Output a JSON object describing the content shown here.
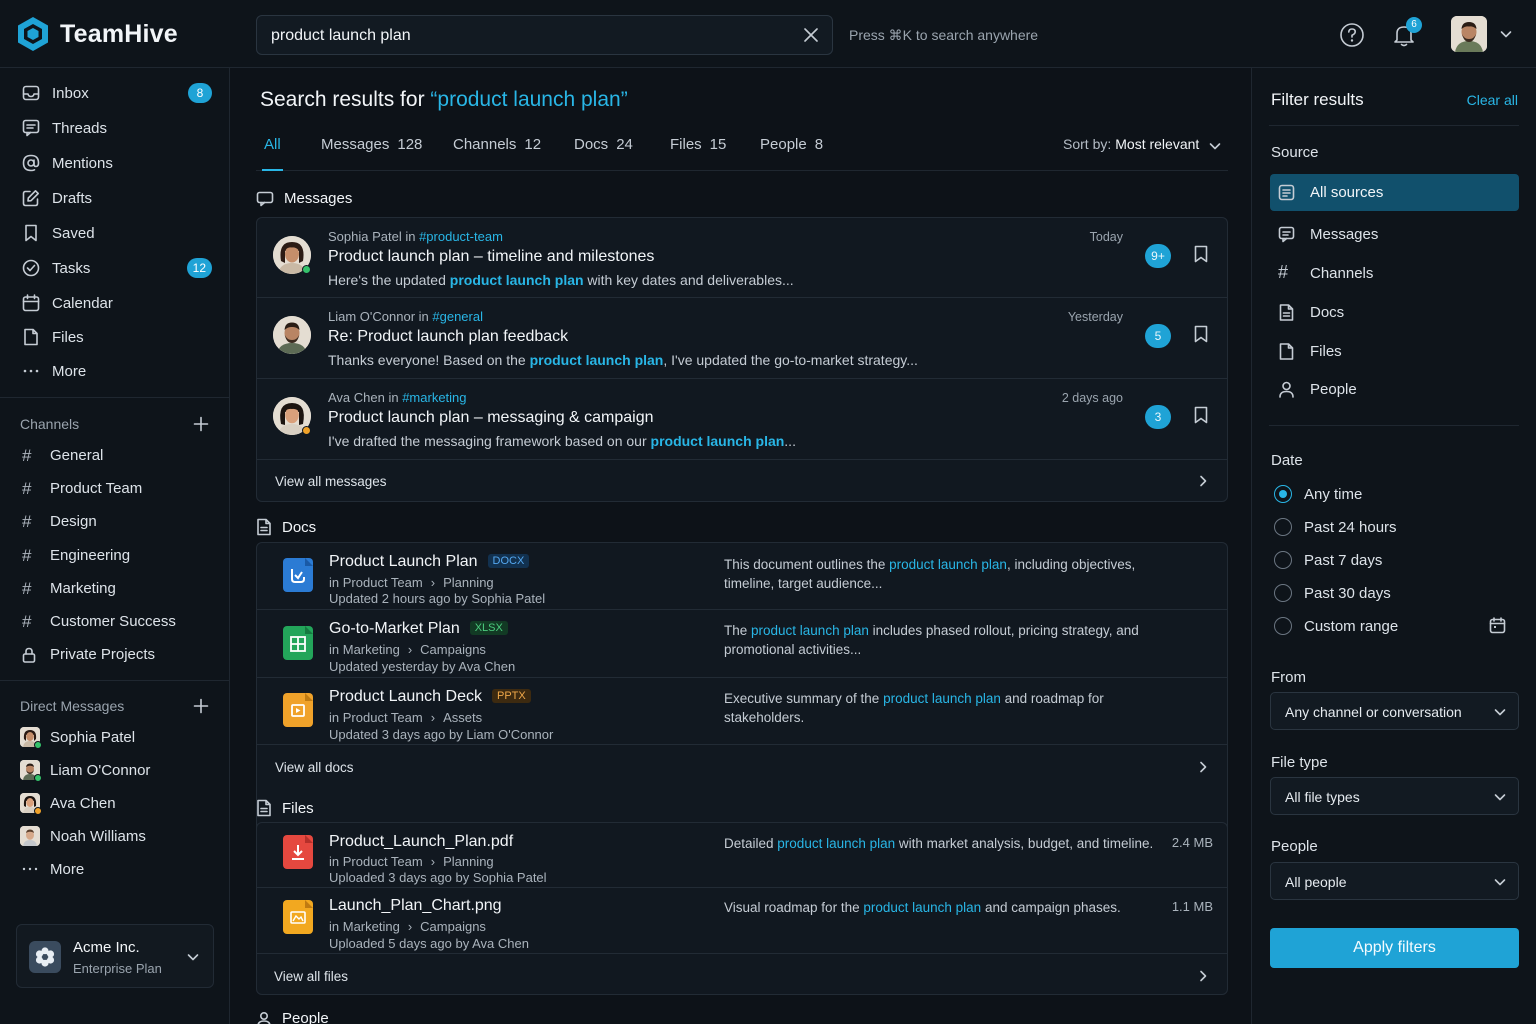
{
  "brand": {
    "name": "TeamHive"
  },
  "search": {
    "value": "product launch plan",
    "hint": "Press ⌘K to search anywhere"
  },
  "topbar": {
    "notification_count": "6"
  },
  "sidebar": {
    "nav": [
      {
        "label": "Inbox",
        "badge": "8"
      },
      {
        "label": "Threads"
      },
      {
        "label": "Mentions"
      },
      {
        "label": "Drafts"
      },
      {
        "label": "Saved"
      },
      {
        "label": "Tasks",
        "badge": "12"
      },
      {
        "label": "Calendar"
      },
      {
        "label": "Files"
      },
      {
        "label": "More"
      }
    ],
    "channels_title": "Channels",
    "channels": [
      "General",
      "Product Team",
      "Design",
      "Engineering",
      "Marketing",
      "Customer Success",
      "Private Projects"
    ],
    "dm_title": "Direct Messages",
    "dms": [
      "Sophia Patel",
      "Liam O'Connor",
      "Ava Chen",
      "Noah Williams"
    ],
    "dm_more": "More",
    "workspace": {
      "name": "Acme Inc.",
      "plan": "Enterprise Plan"
    }
  },
  "main": {
    "title_prefix": "Search results for ",
    "title_query": "“product launch plan”",
    "tabs": [
      {
        "label": "All",
        "count": ""
      },
      {
        "label": "Messages",
        "count": "128"
      },
      {
        "label": "Channels",
        "count": "12"
      },
      {
        "label": "Docs",
        "count": "24"
      },
      {
        "label": "Files",
        "count": "15"
      },
      {
        "label": "People",
        "count": "8"
      }
    ],
    "sort_label": "Sort by:",
    "sort_value": "Most relevant",
    "messages_title": "Messages",
    "messages": [
      {
        "author": "Sophia Patel",
        "in": " in ",
        "channel": "#product-team",
        "time": "Today",
        "title": "Product launch plan – timeline and milestones",
        "pre": "Here's the updated ",
        "hl": "product launch plan",
        "post": " with key dates and deliverables...",
        "count": "9+"
      },
      {
        "author": "Liam O'Connor",
        "in": " in ",
        "channel": "#general",
        "time": "Yesterday",
        "title": "Re: Product launch plan feedback",
        "pre": "Thanks everyone! Based on the ",
        "hl": "product launch plan",
        "post": ", I've updated the go-to-market strategy...",
        "count": "5"
      },
      {
        "author": "Ava Chen",
        "in": " in ",
        "channel": "#marketing",
        "time": "2 days ago",
        "title": "Product launch plan – messaging & campaign",
        "pre": "I've drafted the messaging framework based on our ",
        "hl": "product launch plan",
        "post": "...",
        "count": "3"
      }
    ],
    "view_all_messages": "View all messages",
    "docs_title": "Docs",
    "docs": [
      {
        "title": "Product Launch Plan",
        "tag": "DOCX",
        "in": "in",
        "path1": "Product Team",
        "path2": "Planning",
        "updated": "Updated 2 hours ago by Sophia Patel",
        "pre": "This document outlines the ",
        "hl": "product launch plan",
        "post": ", including objectives, timeline, target audience..."
      },
      {
        "title": "Go-to-Market Plan",
        "tag": "XLSX",
        "in": "in",
        "path1": "Marketing",
        "path2": "Campaigns",
        "updated": "Updated yesterday by Ava Chen",
        "pre": "The ",
        "hl": "product launch plan",
        "post": " includes phased rollout, pricing strategy, and promotional activities..."
      },
      {
        "title": "Product Launch Deck",
        "tag": "PPTX",
        "in": "in",
        "path1": "Product Team",
        "path2": "Assets",
        "updated": "Updated 3 days ago by Liam O'Connor",
        "pre": "Executive summary of the ",
        "hl": "product launch plan",
        "post": " and roadmap for stakeholders."
      }
    ],
    "view_all_docs": "View all docs",
    "files_title": "Files",
    "files": [
      {
        "title": "Product_Launch_Plan.pdf",
        "in": "in",
        "path1": "Product Team",
        "path2": "Planning",
        "updated": "Uploaded 3 days ago by Sophia Patel",
        "pre": "Detailed ",
        "hl": "product launch plan",
        "post": " with market analysis, budget, and timeline.",
        "size": "2.4 MB"
      },
      {
        "title": "Launch_Plan_Chart.png",
        "in": "in",
        "path1": "Marketing",
        "path2": "Campaigns",
        "updated": "Uploaded 5 days ago by Ava Chen",
        "pre": "Visual roadmap for the ",
        "hl": "product launch plan",
        "post": " and campaign phases.",
        "size": "1.1 MB"
      }
    ],
    "view_all_files": "View all files",
    "people_title": "People"
  },
  "filters": {
    "title": "Filter results",
    "clear_all": "Clear all",
    "source_label": "Source",
    "sources": [
      "All sources",
      "Messages",
      "Channels",
      "Docs",
      "Files",
      "People"
    ],
    "date_label": "Date",
    "dates": [
      "Any time",
      "Past 24 hours",
      "Past 7 days",
      "Past 30 days",
      "Custom range"
    ],
    "from_label": "From",
    "from_value": "Any channel or conversation",
    "filetype_label": "File type",
    "filetype_value": "All file types",
    "people_label": "People",
    "people_value": "All people",
    "apply": "Apply filters"
  },
  "colors": {
    "accent": "#29b6e6",
    "badge": "#1fa3d6",
    "background": "#0d1218",
    "online": "#35c26b",
    "docx": "#2b7bd4",
    "xlsx": "#23a55a",
    "pptx": "#f0a22a",
    "pdf": "#e5483f",
    "png": "#f2a820"
  }
}
